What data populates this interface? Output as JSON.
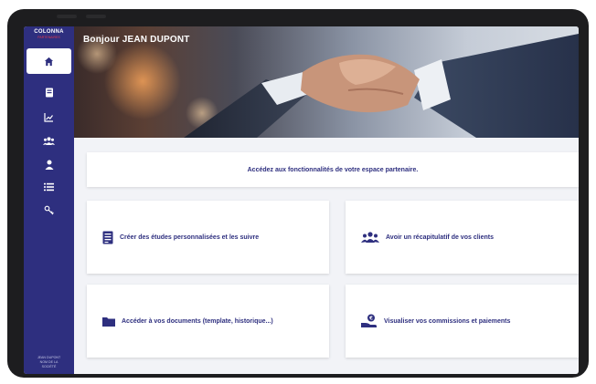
{
  "brand": {
    "name": "COLONNA",
    "sub": "PARTENAIRES"
  },
  "colors": {
    "primary": "#2e2f7f",
    "accent": "#e8394b"
  },
  "sidebar": {
    "items": [
      {
        "icon": "home-icon",
        "active": true
      },
      {
        "icon": "file-icon"
      },
      {
        "icon": "chart-icon"
      },
      {
        "icon": "users-icon"
      },
      {
        "icon": "user-icon"
      },
      {
        "icon": "list-icon"
      },
      {
        "icon": "keys-icon"
      }
    ],
    "user": {
      "line1": "JEAN DUPONT",
      "line2": "NOM DE LA",
      "line3": "SOCIÉTÉ"
    }
  },
  "hero": {
    "greeting": "Bonjour JEAN DUPONT"
  },
  "banner": {
    "text": "Accédez aux fonctionnalités de votre espace partenaire."
  },
  "cards": [
    {
      "icon": "document-icon",
      "label": "Créer des études personnalisées et les suivre"
    },
    {
      "icon": "group-icon",
      "label": "Avoir un récapitulatif de vos clients"
    },
    {
      "icon": "folder-icon",
      "label": "Accéder à vos documents (template, historique...)"
    },
    {
      "icon": "money-hand-icon",
      "label": "Visualiser vos commissions et paiements"
    }
  ]
}
